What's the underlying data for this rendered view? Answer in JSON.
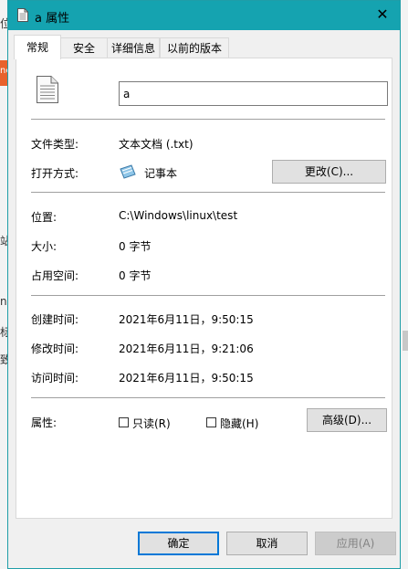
{
  "window": {
    "title": "a 属性",
    "close_icon": "close-icon",
    "file_icon": "text-file-icon"
  },
  "tabs": [
    {
      "label": "常规",
      "active": true
    },
    {
      "label": "安全",
      "active": false
    },
    {
      "label": "详细信息",
      "active": false
    },
    {
      "label": "以前的版本",
      "active": false
    }
  ],
  "general": {
    "file_name": "a",
    "type_label": "文件类型:",
    "type_value": "文本文档 (.txt)",
    "open_with_label": "打开方式:",
    "open_with_value": "记事本",
    "change_button": "更改(C)...",
    "location_label": "位置:",
    "location_value": "C:\\Windows\\linux\\test",
    "size_label": "大小:",
    "size_value": "0 字节",
    "size_on_disk_label": "占用空间:",
    "size_on_disk_value": "0 字节",
    "created_label": "创建时间:",
    "created_value": "2021年6月11日，9:50:15",
    "modified_label": "修改时间:",
    "modified_value": "2021年6月11日，9:21:06",
    "accessed_label": "访问时间:",
    "accessed_value": "2021年6月11日，9:50:15",
    "attributes_label": "属性:",
    "readonly_label": "只读(R)",
    "readonly_checked": false,
    "hidden_label": "隐藏(H)",
    "hidden_checked": false,
    "advanced_button": "高级(D)..."
  },
  "buttons": {
    "ok": "确定",
    "cancel": "取消",
    "apply": "应用(A)"
  },
  "background": {
    "left_chars": [
      "位",
      "ne",
      "站",
      "n",
      "标",
      "致"
    ]
  },
  "colors": {
    "titlebar": "#15a3b0",
    "accent": "#0078d7"
  }
}
